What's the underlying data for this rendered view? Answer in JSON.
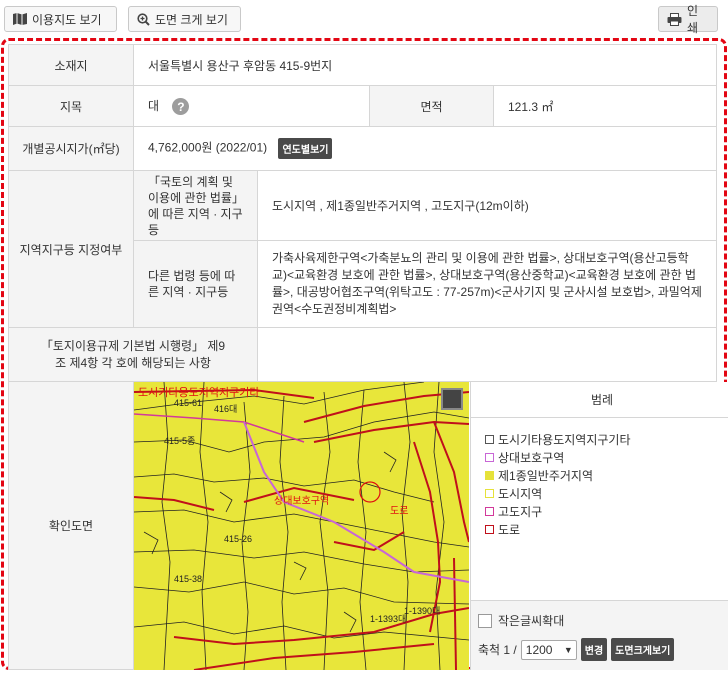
{
  "toolbar": {
    "landuse_map_label": "이용지도 보기",
    "enlarge_map_label": "도면 크게 보기",
    "print_label": "인쇄"
  },
  "info": {
    "location_label": "소재지",
    "location_value": "서울특별시 용산구 후암동 415-9번지",
    "land_category_label": "지목",
    "land_category_value": "대",
    "help_icon_text": "?",
    "area_label": "면적",
    "area_value": "121.3 ㎡",
    "price_label": "개별공시지가(㎡당)",
    "price_value": "4,762,000원 (2022/01)",
    "price_year_button": "연도별보기",
    "zone_label": "지역지구등 지정여부",
    "zone_law1_label": "「국토의 계획 및 이용에 관한 법률」에 따른 지역 · 지구등",
    "zone_law1_value": "도시지역 , 제1종일반주거지역 , 고도지구(12m이하)",
    "zone_law2_label": "다른 법령 등에 따른 지역 · 지구등",
    "zone_law2_value": "가축사육제한구역<가축분뇨의 관리 및 이용에 관한 법률>, 상대보호구역(용산고등학교)<교육환경 보호에 관한 법률>, 상대보호구역(용산중학교)<교육환경 보호에 관한 법률>, 대공방어협조구역(위탁고도 : 77-257m)<군사기지 및 군사시설 보호법>, 과밀억제권역<수도권정비계획법>",
    "enforcement_label": "「토지이용규제 기본법 시행령」 제9조 제4항 각 호에 해당되는 사항",
    "enforcement_value": "",
    "map_label": "확인도면"
  },
  "map": {
    "labels": [
      {
        "text": "도시기타용도지역지구기타",
        "color": "#e01010"
      },
      {
        "text": "415-61",
        "color": "#222"
      },
      {
        "text": "416대",
        "color": "#222"
      },
      {
        "text": "415-5종",
        "color": "#222"
      },
      {
        "text": "상대보호구역",
        "color": "#e01010"
      },
      {
        "text": "도로",
        "color": "#e01010"
      },
      {
        "text": "1-1390대",
        "color": "#222"
      },
      {
        "text": "1-1393대",
        "color": "#222"
      },
      {
        "text": "415-26",
        "color": "#222"
      },
      {
        "text": "415-38",
        "color": "#222"
      }
    ]
  },
  "legend": {
    "title": "범례",
    "items": [
      {
        "label": "도시기타용도지역지구기타",
        "border": "#555555",
        "fill": "#ffffff"
      },
      {
        "label": "상대보호구역",
        "border": "#c866d6",
        "fill": "#ffffff"
      },
      {
        "label": "제1종일반주거지역",
        "border": "#e6e23a",
        "fill": "#e6e23a"
      },
      {
        "label": "도시지역",
        "border": "#e6e23a",
        "fill": "#ffffff"
      },
      {
        "label": "고도지구",
        "border": "#d2399b",
        "fill": "#ffffff"
      },
      {
        "label": "도로",
        "border": "#c0101b",
        "fill": "#ffffff"
      }
    ],
    "small_text_label": "작은글씨확대",
    "scale_label": "축척 1 /",
    "scale_value": "1200",
    "change_button": "변경",
    "enlarge_button": "도면크게보기"
  },
  "colors": {
    "accent_dashed_border": "#e30613",
    "label_bg": "#f4f4f4",
    "map_fill": "#e8e63a",
    "road_red": "#c0101b",
    "protect_purple": "#c866d6"
  }
}
